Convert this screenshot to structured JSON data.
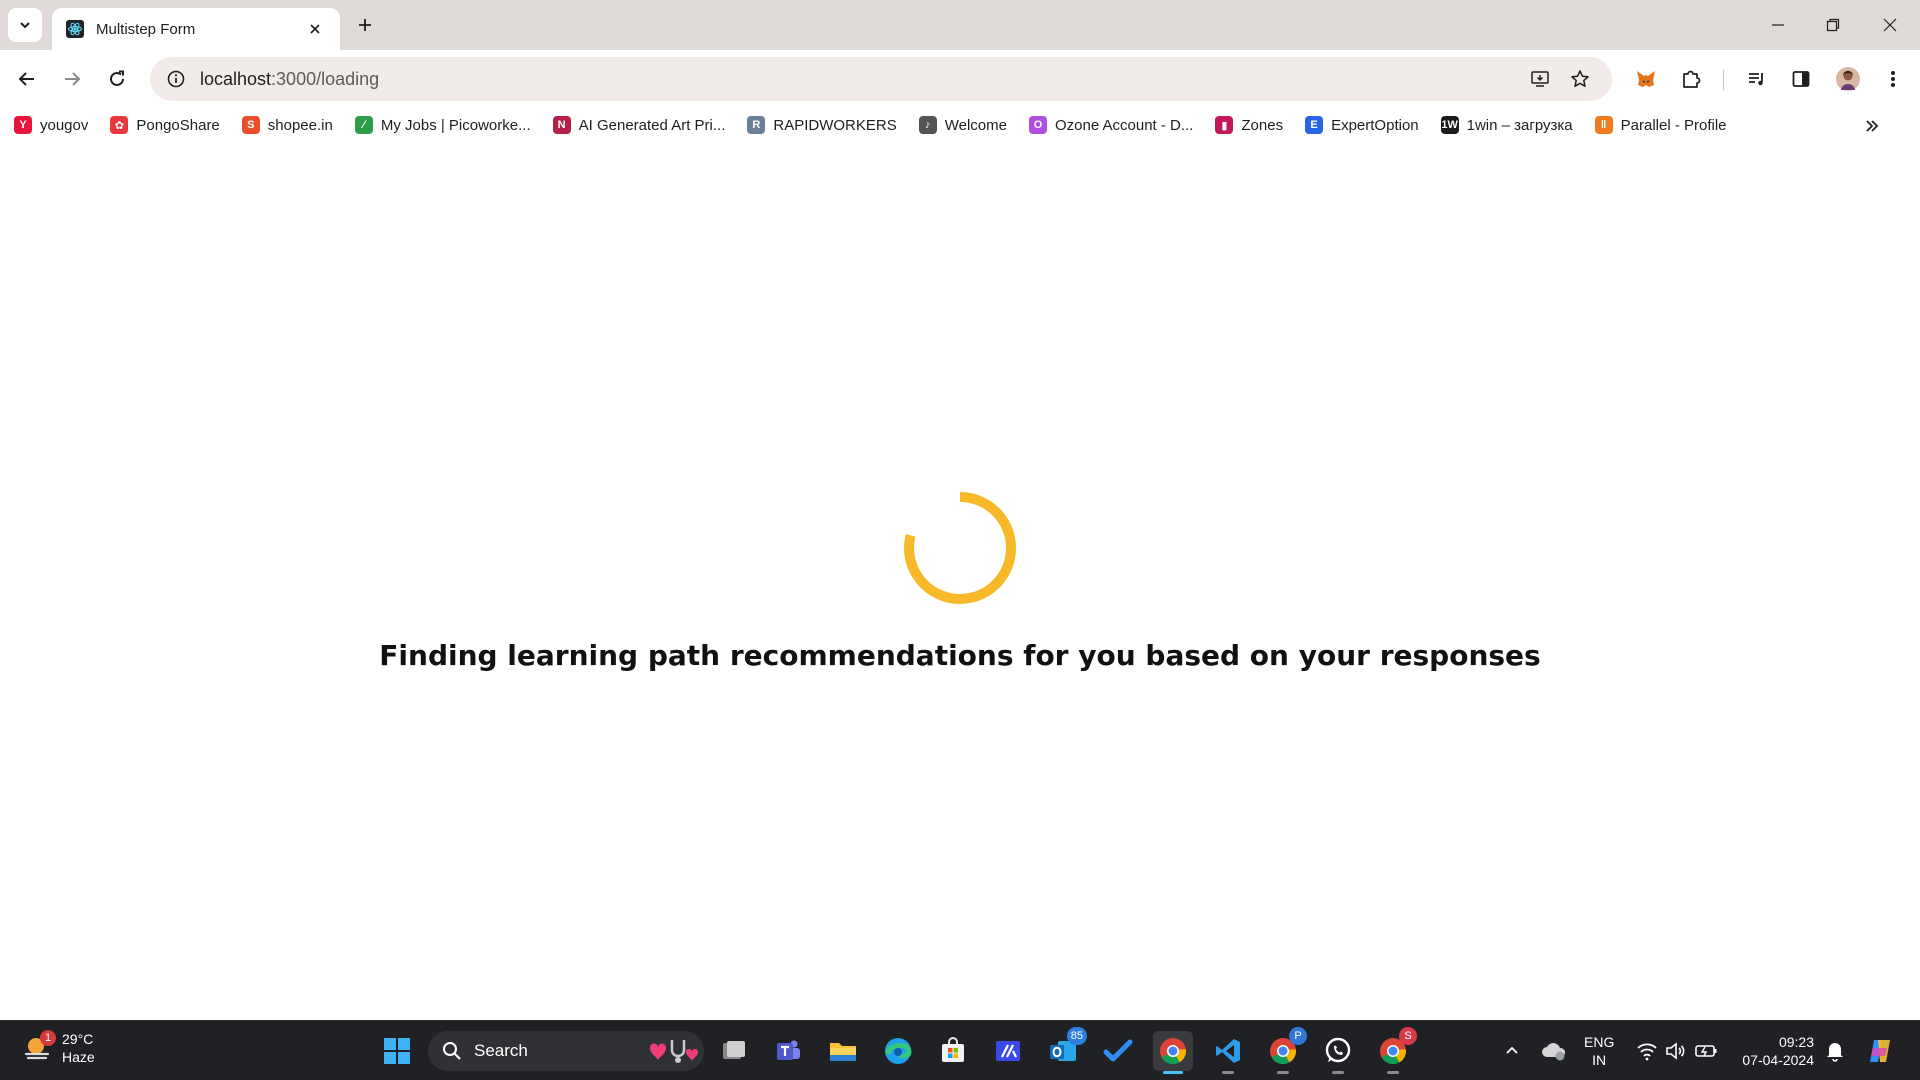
{
  "browser": {
    "tab": {
      "title": "Multistep Form"
    },
    "url": {
      "host": "localhost",
      "rest": ":3000/loading"
    }
  },
  "bookmarks": [
    {
      "label": "yougov",
      "color": "#e8163b",
      "glyph": "Y"
    },
    {
      "label": "PongoShare",
      "color": "#e8383d",
      "glyph": "✿"
    },
    {
      "label": "shopee.in",
      "color": "#ee4d2d",
      "glyph": "S"
    },
    {
      "label": "My Jobs | Picoworke...",
      "color": "#2e9d4a",
      "glyph": "∕"
    },
    {
      "label": "AI Generated Art Pri...",
      "color": "#b2214a",
      "glyph": "N"
    },
    {
      "label": "RAPIDWORKERS",
      "color": "#6b7f99",
      "glyph": "R"
    },
    {
      "label": "Welcome",
      "color": "#555555",
      "glyph": "♪"
    },
    {
      "label": "Ozone Account - D...",
      "color": "#b04ee0",
      "glyph": "O"
    },
    {
      "label": "Zones",
      "color": "#c2185b",
      "glyph": "▮"
    },
    {
      "label": "ExpertOption",
      "color": "#2a65e8",
      "glyph": "E"
    },
    {
      "label": "1win – загрузка",
      "color": "#1a1a1a",
      "glyph": "1W"
    },
    {
      "label": "Parallel - Profile",
      "color": "#f07b1e",
      "glyph": "‖"
    }
  ],
  "page": {
    "message": "Finding learning path recommendations for you based on your responses",
    "spinner_color": "#f7b928"
  },
  "taskbar": {
    "weather": {
      "temp": "29°C",
      "condition": "Haze",
      "badge": "1"
    },
    "search_label": "Search",
    "apps": [
      {
        "name": "start-button-icon"
      },
      {
        "name": "task-view-icon"
      },
      {
        "name": "teams-icon"
      },
      {
        "name": "file-explorer-icon"
      },
      {
        "name": "edge-icon"
      },
      {
        "name": "store-icon"
      },
      {
        "name": "code-app-icon"
      },
      {
        "name": "outlook-icon",
        "badge": "85"
      },
      {
        "name": "todo-icon"
      },
      {
        "name": "chrome-icon"
      },
      {
        "name": "vscode-icon"
      },
      {
        "name": "chrome-profile-p-icon",
        "badge": "P"
      },
      {
        "name": "whatsapp-icon"
      },
      {
        "name": "chrome-profile-s-icon",
        "badge": "S"
      }
    ],
    "language": {
      "line1": "ENG",
      "line2": "IN"
    },
    "time": "09:23",
    "date": "07-04-2024"
  }
}
